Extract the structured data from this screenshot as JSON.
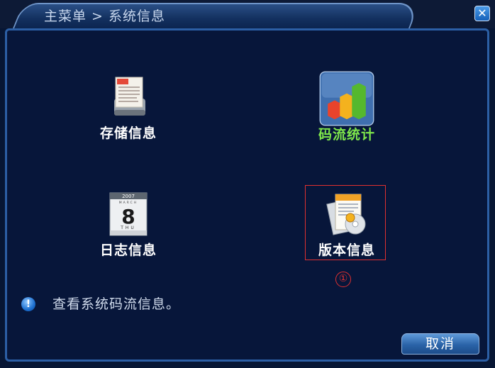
{
  "window": {
    "title": "主菜单 > 系统信息",
    "close_glyph": "✕"
  },
  "tiles": [
    {
      "label": "存储信息",
      "icon": "hdd-document-icon",
      "color": "#ffffff"
    },
    {
      "label": "码流统计",
      "icon": "bar-chart-icon",
      "color": "#7ee64b"
    },
    {
      "label": "日志信息",
      "icon": "calendar-icon",
      "color": "#ffffff"
    },
    {
      "label": "版本信息",
      "icon": "version-document-cd-icon",
      "color": "#ffffff"
    }
  ],
  "calendar": {
    "year": "2007",
    "month": "MARCH",
    "day": "8",
    "weekday": "THU"
  },
  "annotation": {
    "marker": "①",
    "color": "#e03030"
  },
  "status": {
    "icon": "info-icon",
    "glyph": "!",
    "text": "查看系统码流信息。"
  },
  "footer": {
    "cancel_label": "取消"
  }
}
